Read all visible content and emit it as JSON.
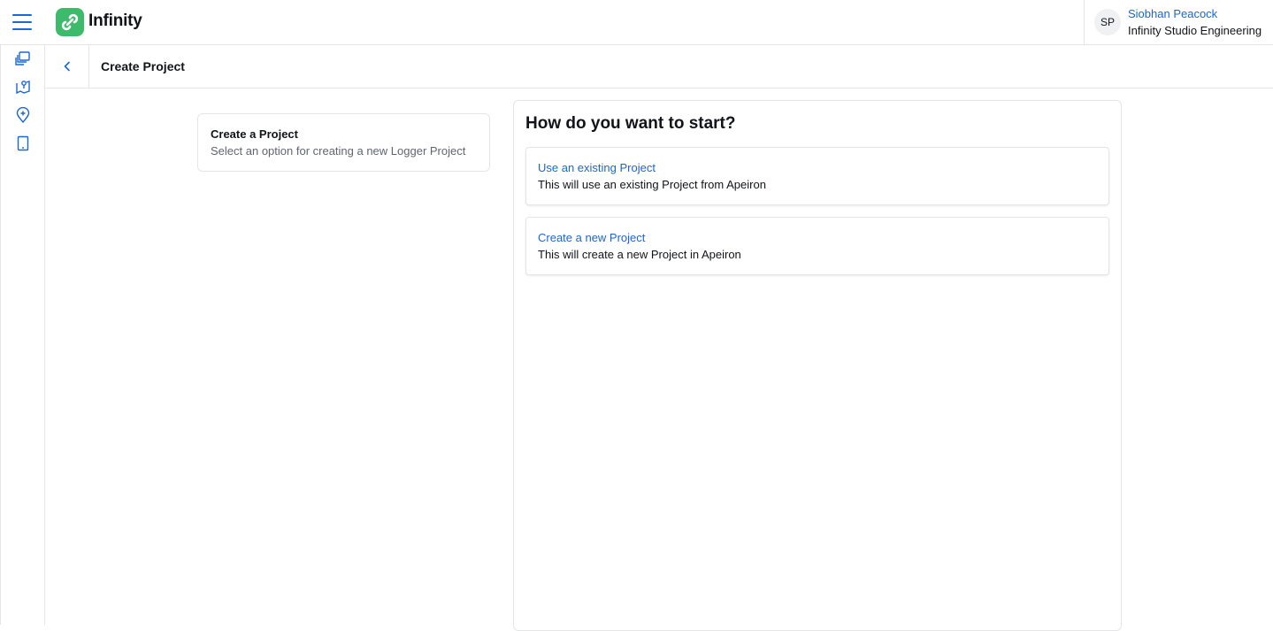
{
  "app": {
    "name": "Infinity"
  },
  "user": {
    "initials": "SP",
    "name": "Siobhan Peacock",
    "organization": "Infinity Studio Engineering"
  },
  "sidebar": {
    "items": [
      {
        "icon": "projects-icon"
      },
      {
        "icon": "map-pin-icon"
      },
      {
        "icon": "add-location-icon"
      },
      {
        "icon": "tablet-icon"
      }
    ]
  },
  "header": {
    "title": "Create Project"
  },
  "step": {
    "title": "Create a Project",
    "subtitle": "Select an option for creating a new Logger Project"
  },
  "main": {
    "heading": "How do you want to start?",
    "options": [
      {
        "title": "Use an existing Project",
        "description": "This will use an existing Project from Apeiron"
      },
      {
        "title": "Create a new Project",
        "description": "This will create a new Project in Apeiron"
      }
    ]
  },
  "colors": {
    "accent": "#1a66d6",
    "logo": "#3dbb6a",
    "border": "#e3e5e8"
  }
}
